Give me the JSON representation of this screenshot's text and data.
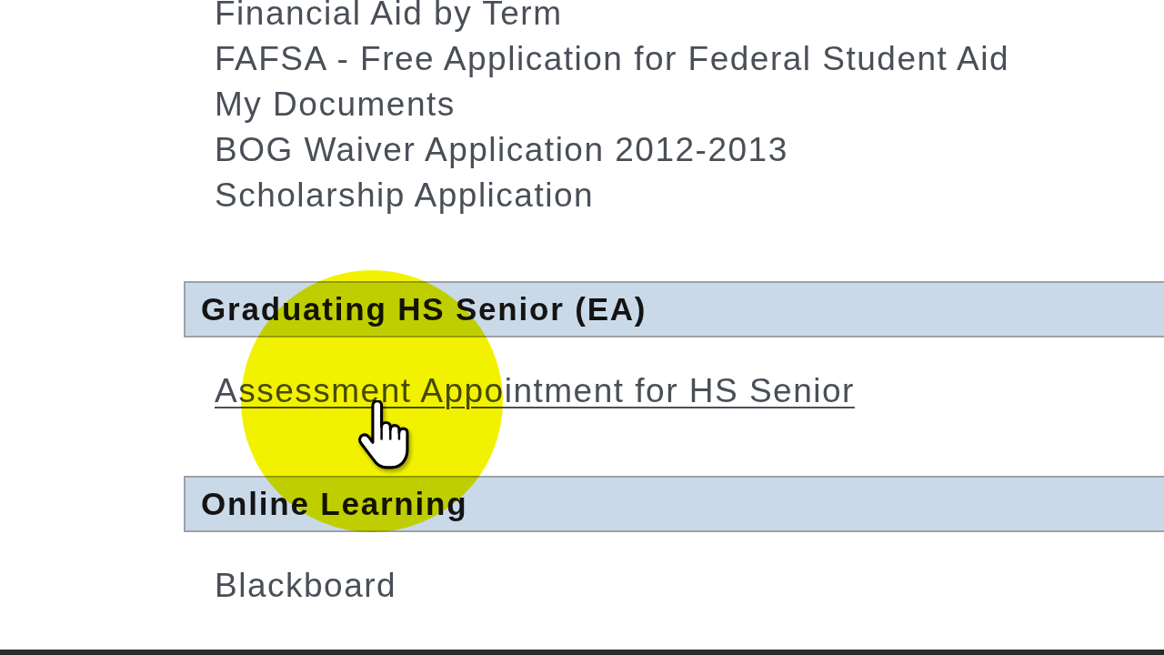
{
  "link_list": [
    {
      "label": "Financial Aid by Term",
      "hovered": false
    },
    {
      "label": "FAFSA - Free Application for Federal Student Aid",
      "hovered": false
    },
    {
      "label": "My Documents",
      "hovered": false
    },
    {
      "label": "BOG Waiver Application 2012-2013",
      "hovered": false
    },
    {
      "label": "Scholarship Application",
      "hovered": false
    }
  ],
  "sections": [
    {
      "title": "Graduating HS Senior (EA)",
      "links": [
        {
          "label": "Assessment Appointment for HS Senior",
          "hovered": true
        }
      ]
    },
    {
      "title": "Online Learning",
      "links": [
        {
          "label": "Blackboard",
          "hovered": false
        }
      ]
    }
  ]
}
